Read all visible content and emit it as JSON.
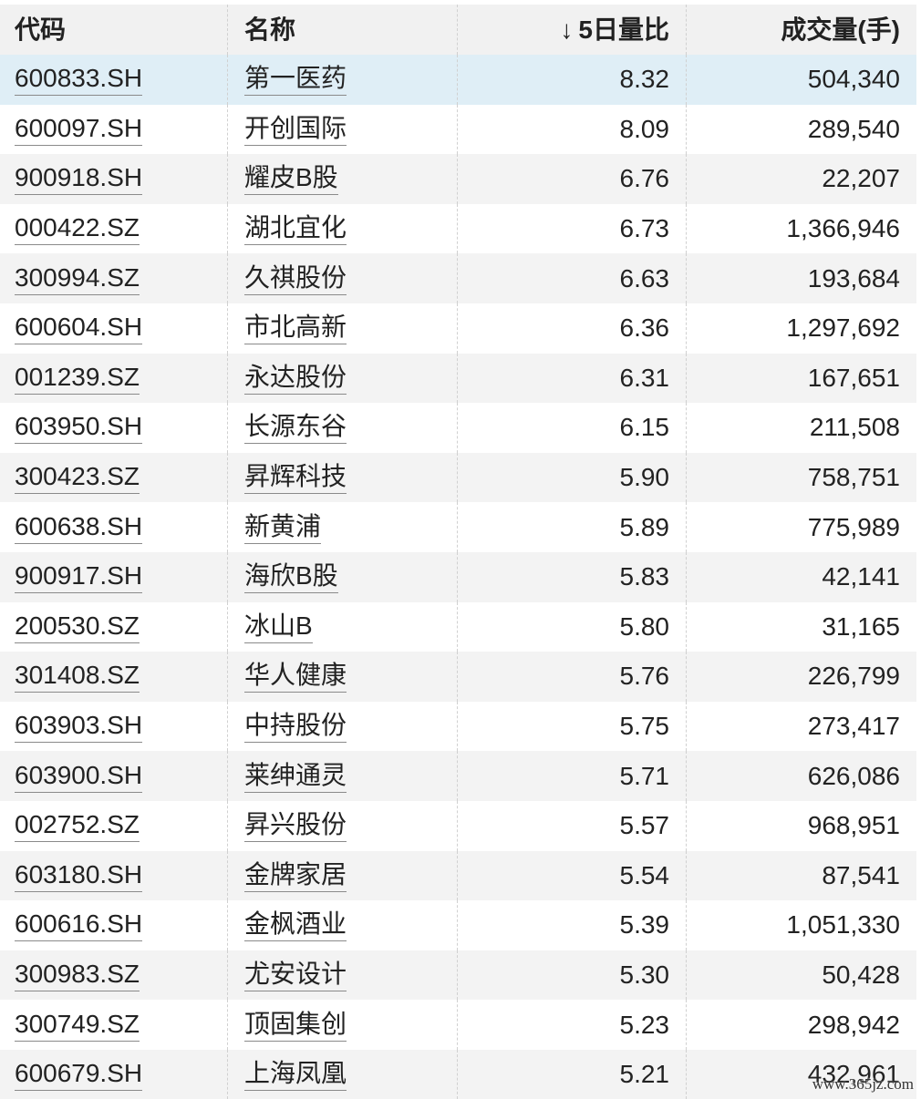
{
  "header": {
    "code": "代码",
    "name": "名称",
    "ratio_arrow": "↓",
    "ratio": "5日量比",
    "volume": "成交量(手)"
  },
  "rows": [
    {
      "code": "600833.SH",
      "name": "第一医药",
      "ratio": "8.32",
      "volume": "504,340"
    },
    {
      "code": "600097.SH",
      "name": "开创国际",
      "ratio": "8.09",
      "volume": "289,540"
    },
    {
      "code": "900918.SH",
      "name": "耀皮B股",
      "ratio": "6.76",
      "volume": "22,207"
    },
    {
      "code": "000422.SZ",
      "name": "湖北宜化",
      "ratio": "6.73",
      "volume": "1,366,946"
    },
    {
      "code": "300994.SZ",
      "name": "久祺股份",
      "ratio": "6.63",
      "volume": "193,684"
    },
    {
      "code": "600604.SH",
      "name": "市北高新",
      "ratio": "6.36",
      "volume": "1,297,692"
    },
    {
      "code": "001239.SZ",
      "name": "永达股份",
      "ratio": "6.31",
      "volume": "167,651"
    },
    {
      "code": "603950.SH",
      "name": "长源东谷",
      "ratio": "6.15",
      "volume": "211,508"
    },
    {
      "code": "300423.SZ",
      "name": "昇辉科技",
      "ratio": "5.90",
      "volume": "758,751"
    },
    {
      "code": "600638.SH",
      "name": "新黄浦",
      "ratio": "5.89",
      "volume": "775,989"
    },
    {
      "code": "900917.SH",
      "name": "海欣B股",
      "ratio": "5.83",
      "volume": "42,141"
    },
    {
      "code": "200530.SZ",
      "name": "冰山B",
      "ratio": "5.80",
      "volume": "31,165"
    },
    {
      "code": "301408.SZ",
      "name": "华人健康",
      "ratio": "5.76",
      "volume": "226,799"
    },
    {
      "code": "603903.SH",
      "name": "中持股份",
      "ratio": "5.75",
      "volume": "273,417"
    },
    {
      "code": "603900.SH",
      "name": "莱绅通灵",
      "ratio": "5.71",
      "volume": "626,086"
    },
    {
      "code": "002752.SZ",
      "name": "昇兴股份",
      "ratio": "5.57",
      "volume": "968,951"
    },
    {
      "code": "603180.SH",
      "name": "金牌家居",
      "ratio": "5.54",
      "volume": "87,541"
    },
    {
      "code": "600616.SH",
      "name": "金枫酒业",
      "ratio": "5.39",
      "volume": "1,051,330"
    },
    {
      "code": "300983.SZ",
      "name": "尤安设计",
      "ratio": "5.30",
      "volume": "50,428"
    },
    {
      "code": "300749.SZ",
      "name": "顶固集创",
      "ratio": "5.23",
      "volume": "298,942"
    },
    {
      "code": "600679.SH",
      "name": "上海凤凰",
      "ratio": "5.21",
      "volume": "432,961"
    }
  ],
  "watermark": "www.365jz.com"
}
